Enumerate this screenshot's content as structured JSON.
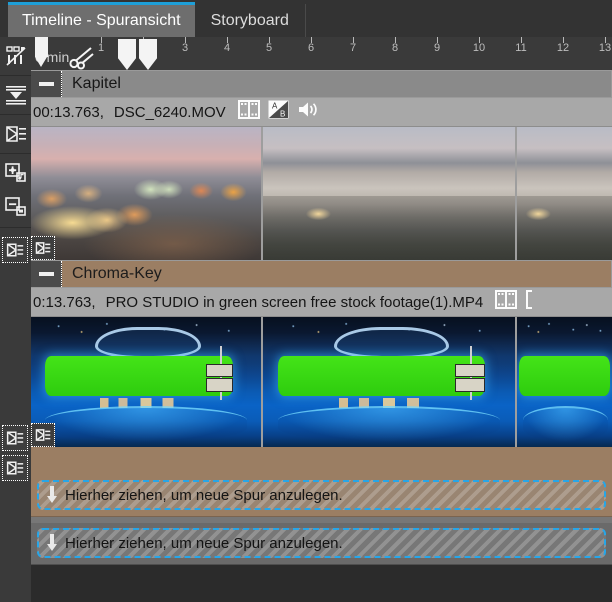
{
  "app": {
    "accent_blue": "#1e9fd8",
    "dropzone_blue": "#27a6e8"
  },
  "tabs": [
    {
      "label": "Timeline - Spuransicht",
      "active": true
    },
    {
      "label": "Storyboard",
      "active": false
    }
  ],
  "toolrail": {
    "items": [
      {
        "name": "track-mode-icon",
        "title": "Spurmodus"
      },
      {
        "name": "insert-down-icon",
        "title": "Einfügen"
      },
      {
        "name": "play-list-icon",
        "title": "Abspielen"
      },
      {
        "name": "add-track-icon",
        "title": "Spur hinzufügen"
      },
      {
        "name": "remove-track-icon",
        "title": "Spur entfernen"
      }
    ]
  },
  "ruler": {
    "zero_label": "0 min",
    "ticks": [
      1,
      2,
      3,
      4,
      5,
      6,
      7,
      8,
      9,
      10,
      11,
      12,
      13
    ],
    "playhead_position": 0,
    "tools": {
      "scissors": "scissors-icon",
      "marker_left": "marker-in-icon",
      "marker_right": "marker-out-icon"
    }
  },
  "tracks": [
    {
      "header_label": "Kapitel",
      "header_color": "#8a8a8a",
      "collapse_name": "collapse-track-kapitel",
      "clip": {
        "timecode": "00:13.763,",
        "filename": "DSC_6240.MOV",
        "icons": [
          "filmstrip-icon",
          "ab-transition-icon",
          "speaker-icon"
        ]
      },
      "thumbnails": [
        "dusk",
        "day",
        "day"
      ]
    },
    {
      "header_label": "Chroma-Key",
      "header_color": "#9b7e63",
      "collapse_name": "collapse-track-chroma-key",
      "clip": {
        "timecode": "0:13.763,",
        "filename": "PRO STUDIO in green screen free stock footage(1).MP4",
        "icons": [
          "filmstrip-icon",
          "bracket-icon"
        ]
      },
      "thumbnails": [
        "studio",
        "studio",
        "studio"
      ]
    }
  ],
  "dropzones": [
    {
      "label": "Hierher ziehen, um neue Spur anzulegen.",
      "variant": "brown"
    },
    {
      "label": "Hierher ziehen, um neue Spur anzulegen.",
      "variant": "grey"
    }
  ]
}
